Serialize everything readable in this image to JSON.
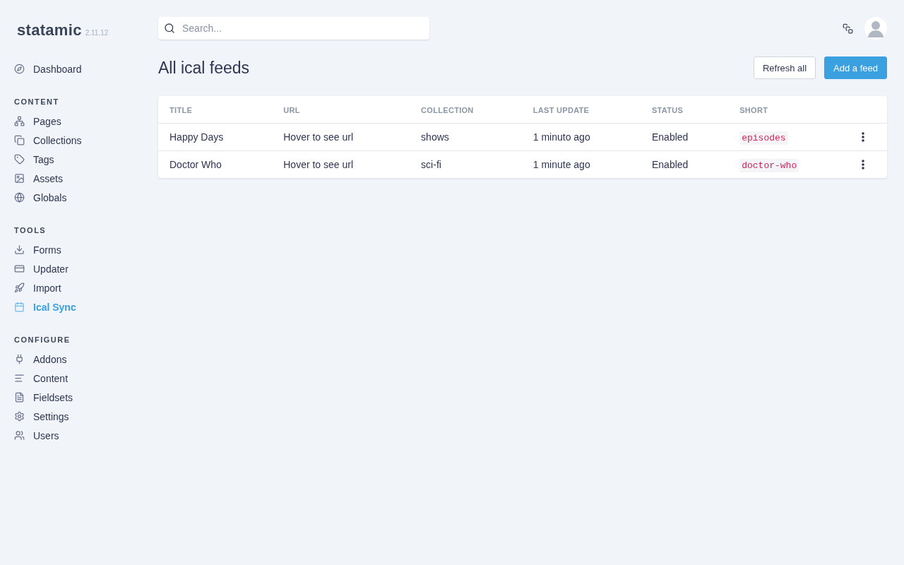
{
  "brand": {
    "name": "statamic",
    "version": "2.11.12"
  },
  "search": {
    "placeholder": "Search..."
  },
  "sidebar": [
    {
      "items": [
        {
          "label": "Dashboard",
          "selected": false
        }
      ]
    },
    {
      "heading": "CONTENT",
      "items": [
        {
          "label": "Pages",
          "selected": false
        },
        {
          "label": "Collections",
          "selected": false
        },
        {
          "label": "Tags",
          "selected": false
        },
        {
          "label": "Assets",
          "selected": false
        },
        {
          "label": "Globals",
          "selected": false
        }
      ]
    },
    {
      "heading": "TOOLS",
      "items": [
        {
          "label": "Forms",
          "selected": false
        },
        {
          "label": "Updater",
          "selected": false
        },
        {
          "label": "Import",
          "selected": false
        },
        {
          "label": "Ical Sync",
          "selected": true
        }
      ]
    },
    {
      "heading": "CONFIGURE",
      "items": [
        {
          "label": "Addons",
          "selected": false
        },
        {
          "label": "Content",
          "selected": false
        },
        {
          "label": "Fieldsets",
          "selected": false
        },
        {
          "label": "Settings",
          "selected": false
        },
        {
          "label": "Users",
          "selected": false
        }
      ]
    }
  ],
  "page": {
    "title": "All ical feeds",
    "buttons": [
      {
        "label": "Refresh all",
        "kind": "secondary"
      },
      {
        "label": "Add a feed",
        "kind": "primary"
      }
    ]
  },
  "table": {
    "columns": [
      "TITLE",
      "URL",
      "COLLECTION",
      "LAST UPDATE",
      "STATUS",
      "SHORT"
    ],
    "rows": [
      {
        "title": "Happy Days",
        "url": "Hover to see url",
        "collection": "shows",
        "last_update": "1 minuto ago",
        "status": "Enabled",
        "short": "episodes"
      },
      {
        "title": "Doctor Who",
        "url": "Hover to see url",
        "collection": "sci-fi",
        "last_update": "1 minute ago",
        "status": "Enabled",
        "short": "doctor-who"
      }
    ]
  }
}
